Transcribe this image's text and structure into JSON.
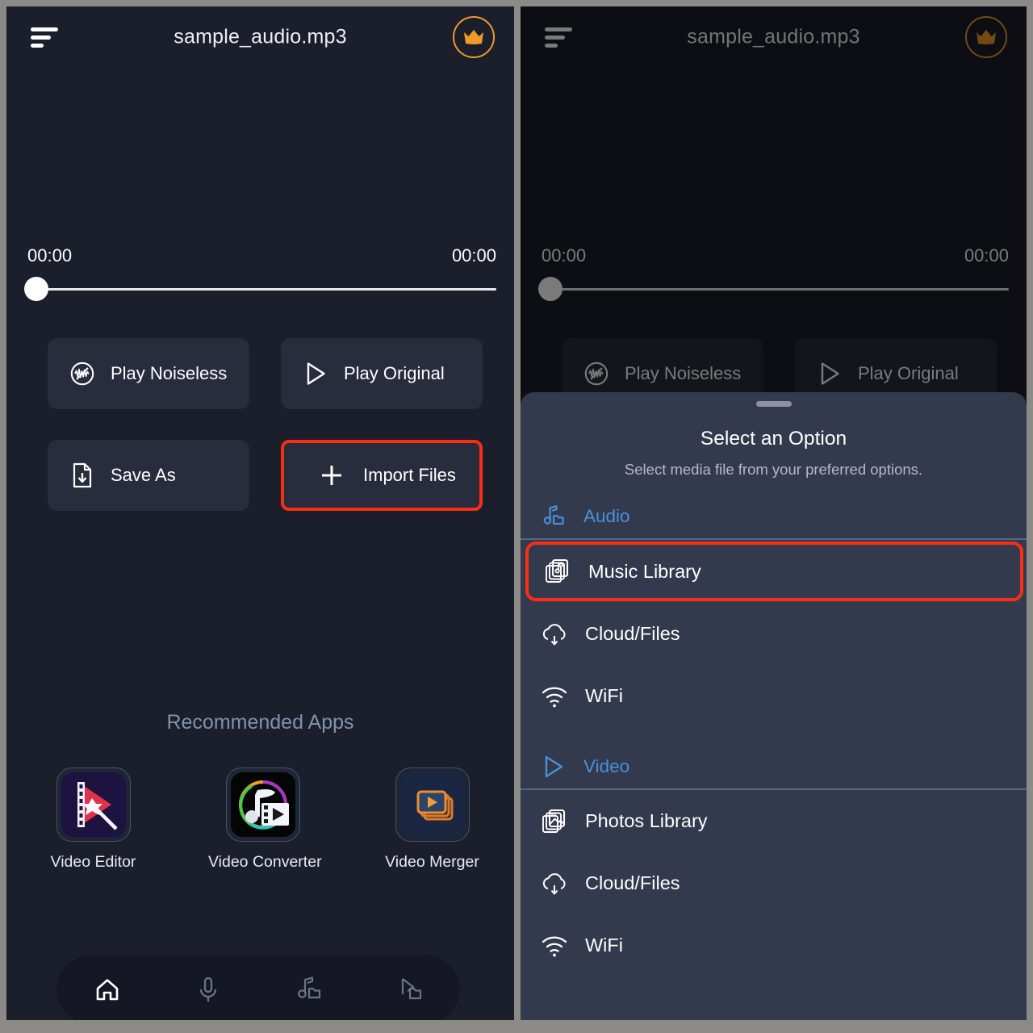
{
  "app": {
    "header": {
      "menu_icon": "hamburger-sort-icon",
      "title": "sample_audio.mp3",
      "premium_icon": "crown-icon"
    },
    "player": {
      "current_time": "00:00",
      "total_time": "00:00",
      "progress_percent": 0
    },
    "actions": [
      {
        "label": "Play Noiseless",
        "icon": "noise-cancel-waveform-icon",
        "highlighted": false
      },
      {
        "label": "Play Original",
        "icon": "play-outline-icon",
        "highlighted": false
      },
      {
        "label": "Save As",
        "icon": "file-download-icon",
        "highlighted": false
      },
      {
        "label": "Import Files",
        "icon": "plus-icon",
        "highlighted": true
      }
    ],
    "recommended": {
      "section_title": "Recommended Apps",
      "apps": [
        {
          "label": "Video Editor",
          "icon": "video-editor-app-icon"
        },
        {
          "label": "Video Converter",
          "icon": "video-converter-app-icon"
        },
        {
          "label": "Video Merger",
          "icon": "video-merger-app-icon"
        }
      ]
    },
    "bottom_nav": [
      {
        "icon": "home-icon",
        "active": true
      },
      {
        "icon": "microphone-icon",
        "active": false
      },
      {
        "icon": "music-folder-icon",
        "active": false
      },
      {
        "icon": "video-folder-icon",
        "active": false
      }
    ]
  },
  "sheet": {
    "handle_icon": "drag-handle",
    "title": "Select an Option",
    "subtitle": "Select media file from your preferred options.",
    "sections": [
      {
        "header": {
          "label": "Audio",
          "icon": "music-folder-icon"
        },
        "items": [
          {
            "label": "Music Library",
            "icon": "music-library-stack-icon",
            "highlighted": true
          },
          {
            "label": "Cloud/Files",
            "icon": "cloud-download-icon",
            "highlighted": false
          },
          {
            "label": "WiFi",
            "icon": "wifi-icon",
            "highlighted": false
          }
        ]
      },
      {
        "header": {
          "label": "Video",
          "icon": "play-outline-icon"
        },
        "items": [
          {
            "label": "Photos Library",
            "icon": "photos-library-stack-icon",
            "highlighted": false
          },
          {
            "label": "Cloud/Files",
            "icon": "cloud-download-icon",
            "highlighted": false
          },
          {
            "label": "WiFi",
            "icon": "wifi-icon",
            "highlighted": false
          }
        ]
      }
    ]
  },
  "colors": {
    "page_border": "#8b8a86",
    "screen_bg": "#1b1e2b",
    "button_bg": "#282c3c",
    "sheet_bg": "#343a4e",
    "accent_blue": "#4a90d9",
    "accent_orange": "#f09a2a",
    "highlight_red": "#fb2d13",
    "muted_text": "#7f93ad"
  }
}
